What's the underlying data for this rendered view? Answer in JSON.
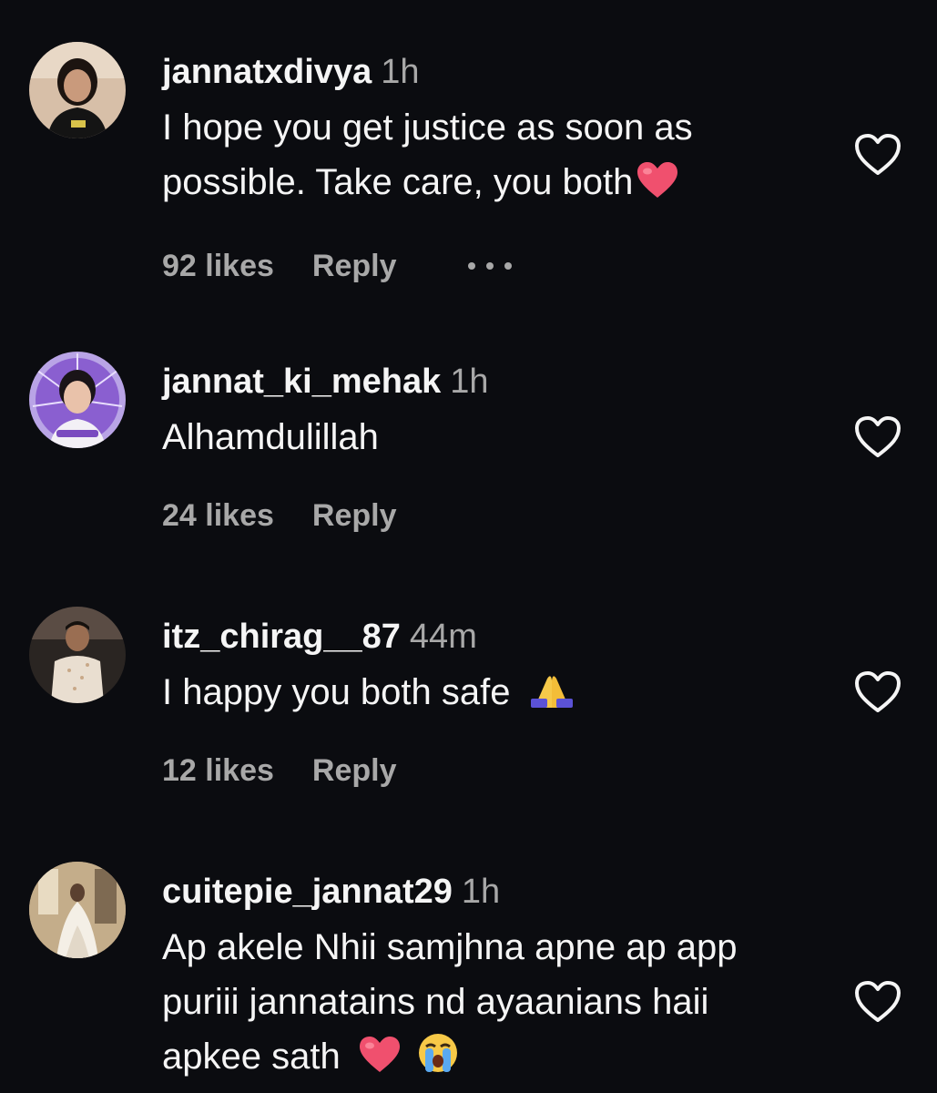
{
  "comments": [
    {
      "username": "jannatxdivya",
      "time": "1h",
      "text": "I hope you get justice as soon as possible. Take care, you both",
      "emoji": "red-heart",
      "likes": "92 likes",
      "reply": "Reply",
      "has_more": true
    },
    {
      "username": "jannat_ki_mehak",
      "time": "1h",
      "text": "Alhamdulillah",
      "likes": "24 likes",
      "reply": "Reply"
    },
    {
      "username": "itz_chirag__87",
      "time": "44m",
      "text": "I happy you both safe",
      "emoji": "folded-hands",
      "likes": "12 likes",
      "reply": "Reply"
    },
    {
      "username": "cuitepie_jannat29",
      "time": "1h",
      "text": "Ap akele Nhii samjhna apne ap app puriii jannatains nd ayaanians haii apkee sath",
      "emoji": "red-heart, loudly-crying-face"
    }
  ],
  "colors": {
    "background": "#0b0c10",
    "primary_text": "#f5f5f5",
    "secondary_text": "#a8a8a8",
    "heart_emoji": "#f0506e"
  },
  "icons": {
    "like": "heart-outline-icon",
    "more": "more-options-icon"
  }
}
